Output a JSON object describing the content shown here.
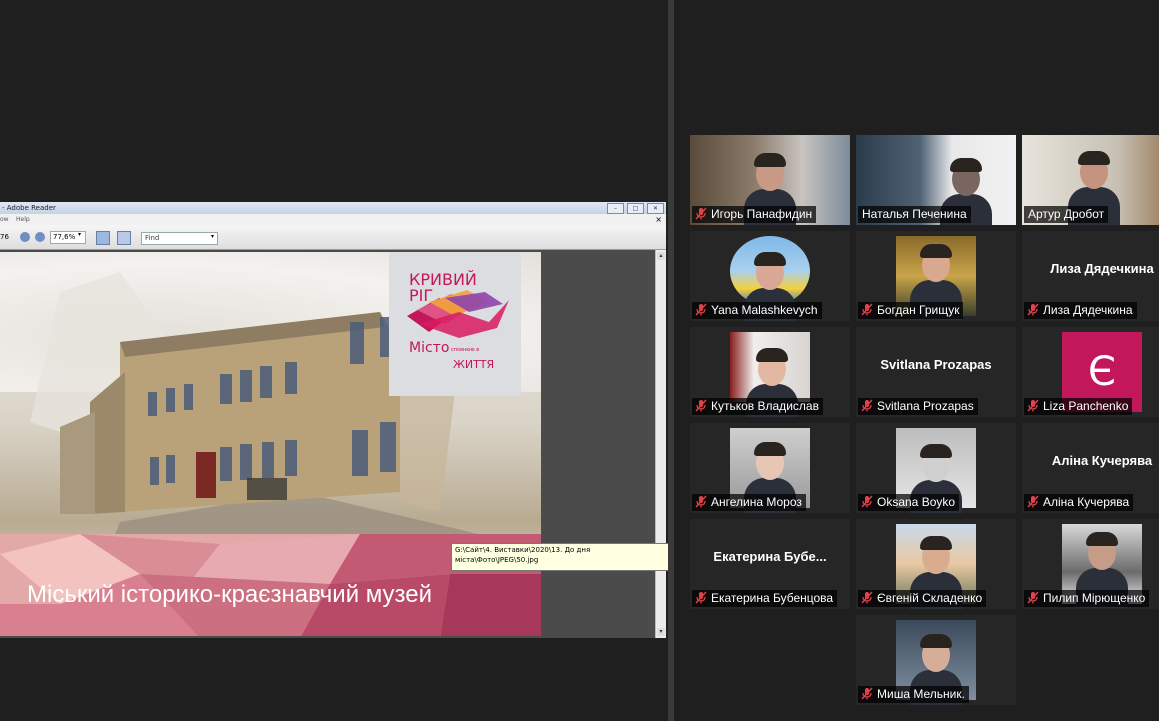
{
  "reader": {
    "title": "- Adobe Reader",
    "menu": [
      "ow",
      "Help"
    ],
    "page_number": "76",
    "zoom": "77,6%",
    "find_placeholder": "Find",
    "doc": {
      "logo_line1": "КРИВИЙ",
      "logo_line2": "РІГ",
      "logo_city": "Місто",
      "logo_small": "сповнюю в",
      "logo_life": "ЖИТТЯ",
      "museum_title": "Міський історико-краєзнавчий музей"
    },
    "tooltip": "G:\\Сайт\\4. Виставки\\2020\\13. До дня міста\\Фото\\JPEG\\50.jpg"
  },
  "participants": [
    {
      "name": "Игорь Панафидин",
      "muted": true,
      "video": true
    },
    {
      "name": "Наталья Печенина",
      "muted": false,
      "video": true
    },
    {
      "name": "Артур Дробот",
      "muted": false,
      "video": true,
      "active_speaker": true
    },
    {
      "name": "Yana Malashkevych",
      "muted": true,
      "video": true
    },
    {
      "name": "Богдан Грищук",
      "muted": true,
      "video": true
    },
    {
      "name": "Лиза Дядечкина",
      "muted": true,
      "video": false,
      "display_name": "Лиза Дядечкина"
    },
    {
      "name": "Кутьков Владислав",
      "muted": true,
      "video": true
    },
    {
      "name": "Svitlana Prozapas",
      "muted": true,
      "video": false,
      "display_name": "Svitlana Prozapas"
    },
    {
      "name": "Liza Panchenko",
      "muted": true,
      "video": false,
      "avatar_letter": "Є"
    },
    {
      "name": "Ангелина Мороз",
      "muted": true,
      "video": true
    },
    {
      "name": "Oksana Boyko",
      "muted": true,
      "video": true
    },
    {
      "name": "Аліна Кучерява",
      "muted": true,
      "video": false,
      "display_name": "Аліна Кучерява"
    },
    {
      "name": "Екатерина Бубенцова",
      "muted": true,
      "video": false,
      "display_name": "Екатерина  Бубе..."
    },
    {
      "name": "Євгеній Складенко",
      "muted": true,
      "video": true
    },
    {
      "name": "Пилип Мірющенко",
      "muted": true,
      "video": true
    },
    {
      "name": "Миша Мельник.",
      "muted": true,
      "video": true
    }
  ],
  "colors": {
    "background": "#1f1f1f",
    "tile": "#262626",
    "active_speaker_border": "#cdeb43",
    "muted_icon": "#e5414a",
    "brand_magenta": "#c2185b"
  }
}
